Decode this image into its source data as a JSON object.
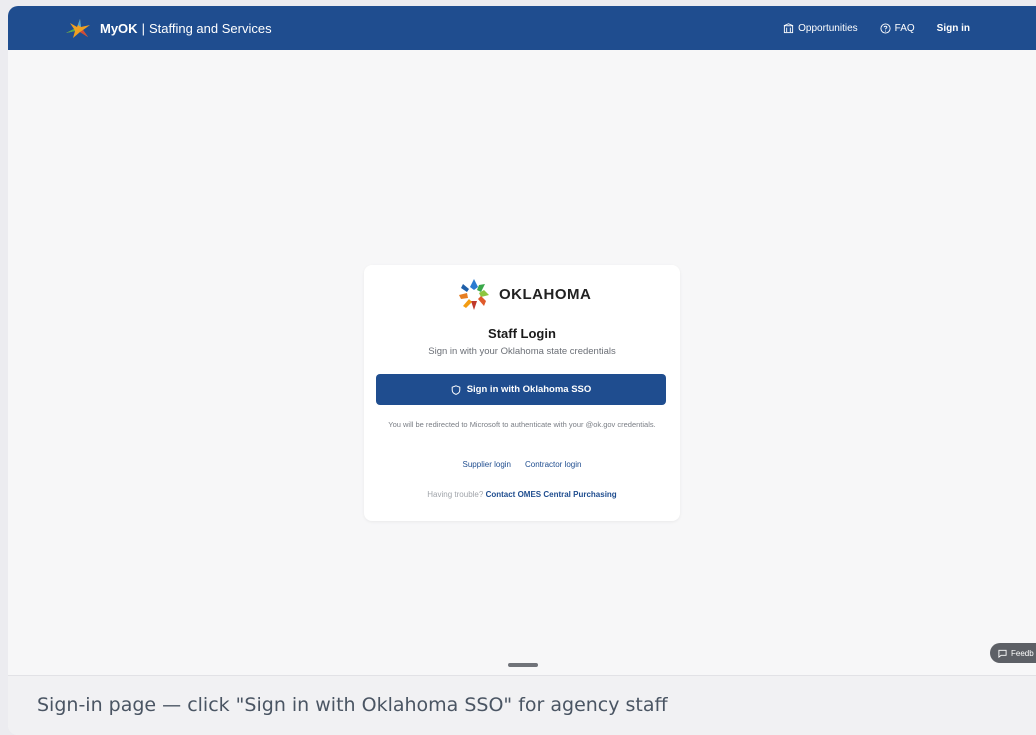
{
  "header": {
    "brand_name": "MyOK",
    "brand_separator": "|",
    "brand_subtitle": "Staffing and Services",
    "logo_icon": "oklahoma-star-logo-icon",
    "nav": [
      {
        "label": "Opportunities",
        "icon": "building-icon"
      },
      {
        "label": "FAQ",
        "icon": "help-circle-icon"
      },
      {
        "label": "Sign in"
      }
    ],
    "bg_color": "#1f4d8f"
  },
  "login_card": {
    "logo_text": "OKLAHOMA",
    "title": "Staff Login",
    "subtitle": "Sign in with your Oklahoma state credentials",
    "sso_button_label": "Sign in with Oklahoma SSO",
    "sso_button_icon": "shield-icon",
    "redirect_notice": "You will be redirected to Microsoft to authenticate with your @ok.gov credentials.",
    "supplier_link": "Supplier login",
    "contractor_link": "Contractor login",
    "trouble_text": "Having trouble?",
    "trouble_link": "Contact OMES Central Purchasing",
    "accent_color": "#1f4d8f"
  },
  "feedback_button": {
    "label": "Feedb",
    "icon": "message-square-icon"
  },
  "caption": "Sign-in page — click \"Sign in with Oklahoma SSO\" for agency staff"
}
